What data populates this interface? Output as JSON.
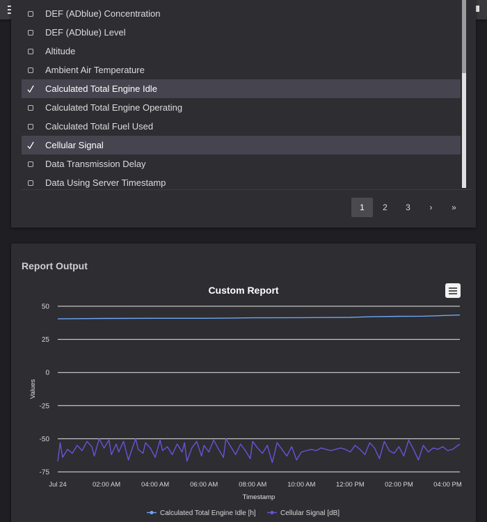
{
  "list": {
    "items": [
      {
        "label": "DEF (ADblue) Concentration",
        "checked": false
      },
      {
        "label": "DEF (ADblue) Level",
        "checked": false
      },
      {
        "label": "Altitude",
        "checked": false
      },
      {
        "label": "Ambient Air Temperature",
        "checked": false
      },
      {
        "label": "Calculated Total Engine Idle",
        "checked": true
      },
      {
        "label": "Calculated Total Engine Operating",
        "checked": false
      },
      {
        "label": "Calculated Total Fuel Used",
        "checked": false
      },
      {
        "label": "Cellular Signal",
        "checked": true
      },
      {
        "label": "Data Transmission Delay",
        "checked": false
      },
      {
        "label": "Data Using Server Timestamp",
        "checked": false
      }
    ]
  },
  "pagination": {
    "pages": [
      "1",
      "2",
      "3"
    ],
    "current": "1",
    "next": "›",
    "last": "»"
  },
  "report": {
    "title": "Report Output"
  },
  "chart_data": {
    "type": "line",
    "title": "Custom Report",
    "xlabel": "Timestamp",
    "ylabel": "Values",
    "ylim": [
      -75,
      50
    ],
    "yticks": [
      "50",
      "25",
      "0",
      "-25",
      "-50",
      "-75"
    ],
    "xticks": [
      "Jul 24",
      "02:00 AM",
      "04:00 AM",
      "06:00 AM",
      "08:00 AM",
      "10:00 AM",
      "12:00 PM",
      "02:00 PM",
      "04:00 PM"
    ],
    "x_hours": [
      0,
      2,
      4,
      6,
      8,
      10,
      12,
      14,
      16
    ],
    "grid": true,
    "legend": "bottom-center",
    "series": [
      {
        "name": "Calculated Total Engine Idle [h]",
        "color": "#6ea6f5",
        "hours": [
          0,
          2,
          4,
          6,
          7,
          8,
          10,
          11,
          12,
          13,
          14,
          15,
          16.5
        ],
        "values": [
          40.5,
          40.8,
          40.9,
          40.9,
          41.0,
          41.3,
          41.4,
          41.5,
          41.6,
          42.2,
          42.4,
          42.5,
          43.4
        ]
      },
      {
        "name": "Cellular Signal [dB]",
        "color": "#6655d8",
        "hours": [
          0.0,
          0.1,
          0.2,
          0.4,
          0.6,
          0.8,
          1.0,
          1.2,
          1.4,
          1.5,
          1.7,
          1.9,
          2.1,
          2.2,
          2.4,
          2.5,
          2.7,
          2.9,
          3.1,
          3.2,
          3.3,
          3.5,
          3.6,
          3.8,
          4.0,
          4.2,
          4.3,
          4.5,
          4.7,
          4.9,
          5.1,
          5.2,
          5.3,
          5.5,
          5.7,
          5.9,
          6.0,
          6.2,
          6.4,
          6.6,
          6.8,
          6.9,
          7.1,
          7.3,
          7.5,
          7.7,
          7.9,
          8.0,
          8.2,
          8.4,
          8.6,
          8.8,
          9.0,
          9.2,
          9.4,
          9.6,
          9.8,
          10.0,
          10.2,
          10.4,
          10.6,
          10.8,
          11.0,
          11.2,
          11.4,
          11.6,
          11.8,
          12.0,
          12.2,
          12.4,
          12.6,
          12.8,
          13.0,
          13.2,
          13.4,
          13.6,
          13.8,
          14.0,
          14.2,
          14.4,
          14.6,
          14.8,
          15.0,
          15.2,
          15.4,
          15.6,
          15.8,
          16.0,
          16.2,
          16.5
        ],
        "values": [
          -67,
          -53,
          -64,
          -58,
          -61,
          -55,
          -59,
          -52,
          -56,
          -63,
          -50,
          -57,
          -51,
          -62,
          -54,
          -60,
          -52,
          -66,
          -55,
          -50,
          -58,
          -61,
          -53,
          -57,
          -64,
          -51,
          -59,
          -56,
          -62,
          -54,
          -60,
          -53,
          -67,
          -57,
          -52,
          -63,
          -55,
          -60,
          -51,
          -58,
          -64,
          -50,
          -56,
          -62,
          -54,
          -59,
          -65,
          -52,
          -57,
          -61,
          -55,
          -68,
          -53,
          -58,
          -63,
          -56,
          -66,
          -60,
          -59,
          -58,
          -59,
          -57,
          -58,
          -59,
          -58,
          -57,
          -58,
          -60,
          -55,
          -58,
          -62,
          -53,
          -57,
          -65,
          -52,
          -59,
          -61,
          -56,
          -63,
          -51,
          -58,
          -66,
          -55,
          -60,
          -57,
          -58,
          -56,
          -59,
          -58,
          -54
        ]
      }
    ]
  }
}
